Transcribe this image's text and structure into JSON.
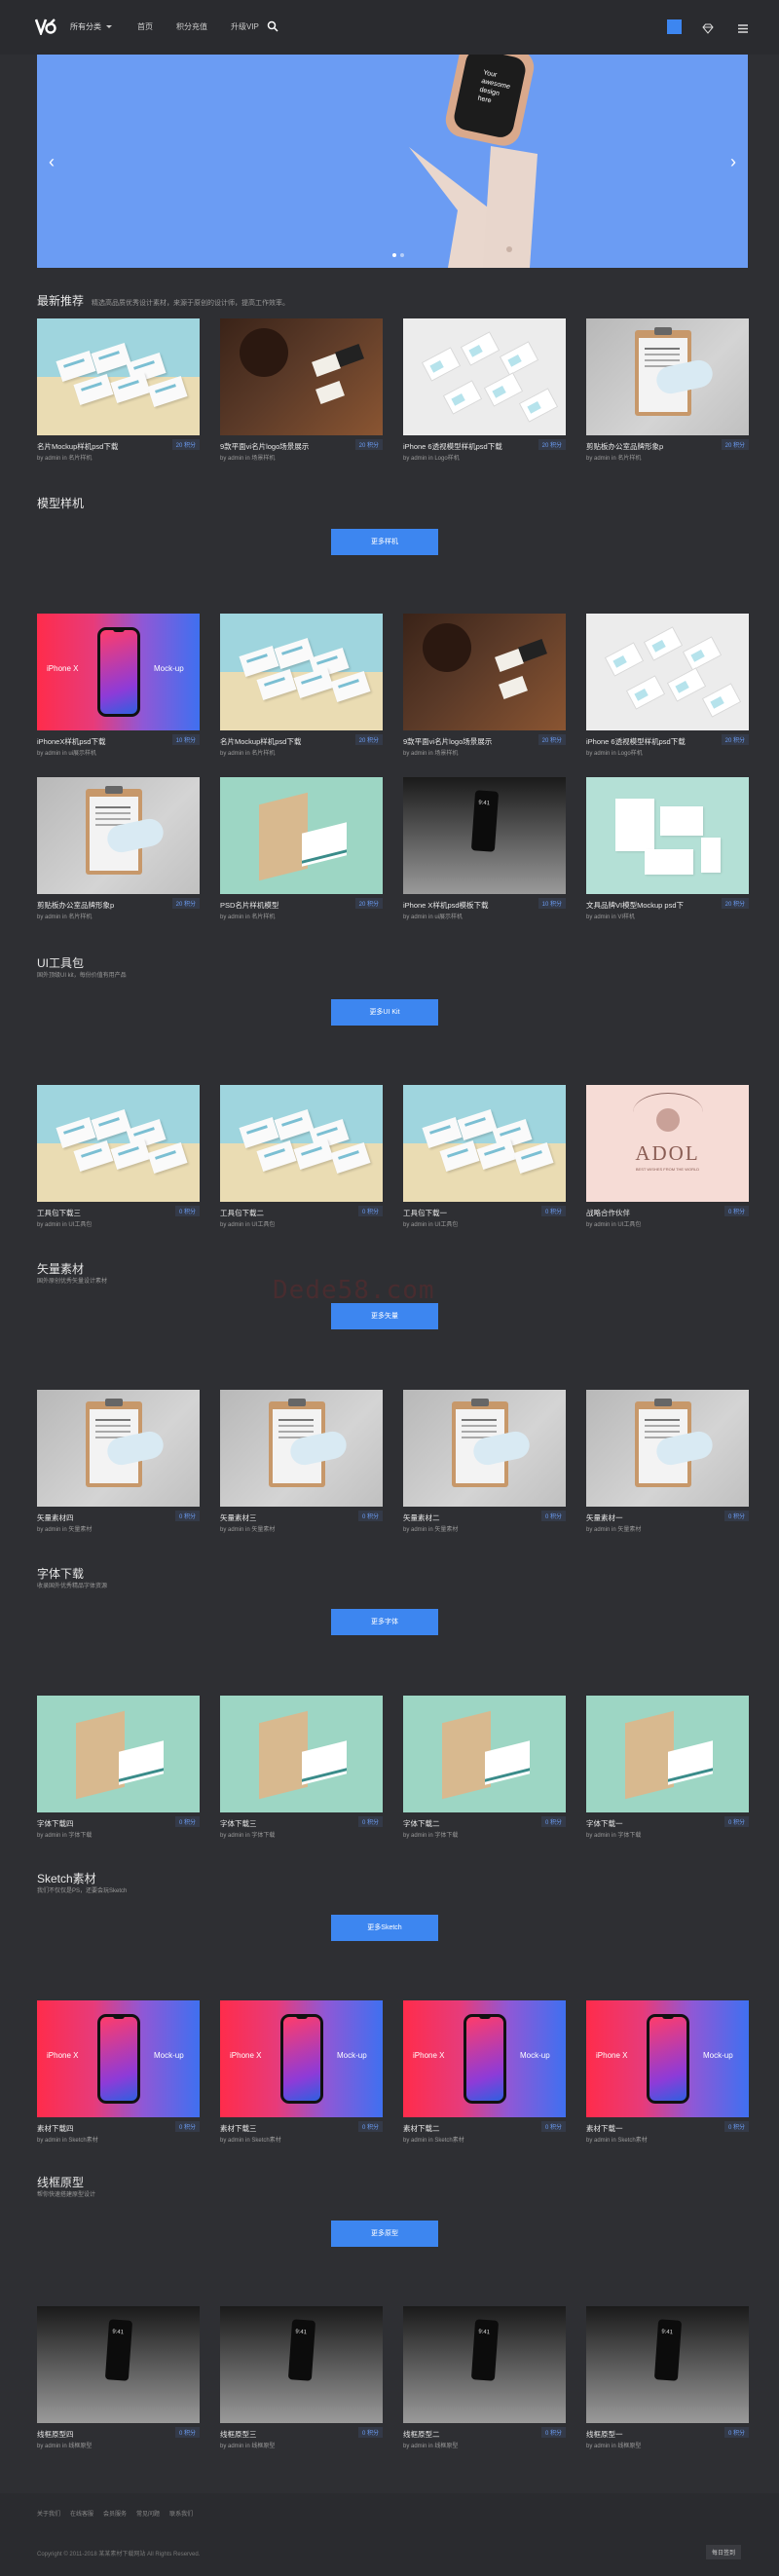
{
  "header": {
    "categories_label": "所有分类",
    "nav": [
      "首页",
      "积分充值",
      "升级VIP"
    ]
  },
  "banner": {
    "watch_text": "Your awesome design here"
  },
  "latest": {
    "title": "最新推荐",
    "subtitle": "精选高品质优秀设计素材，来源于原创的设计师，提高工作效率。",
    "cards": [
      {
        "title": "名片Mockup样机psd下载",
        "by": "by admin in 名片样机",
        "points": "20 积分",
        "art": "cards"
      },
      {
        "title": "9款平面vi名片logo场景展示",
        "by": "by admin in 场景样机",
        "points": "20 积分",
        "art": "dark"
      },
      {
        "title": "iPhone 6透视模型样机psd下载",
        "by": "by admin in Logo样机",
        "points": "20 积分",
        "art": "white"
      },
      {
        "title": "剪贴板办公室品牌形象p",
        "by": "by admin in 名片样机",
        "points": "20 积分",
        "art": "clip"
      }
    ]
  },
  "sections": [
    {
      "title": "模型样机",
      "subtitle": "",
      "button": "更多样机",
      "cards": [
        {
          "title": "iPhoneX样机psd下载",
          "by": "by admin in ui展示样机",
          "points": "10 积分",
          "art": "iphone"
        },
        {
          "title": "名片Mockup样机psd下载",
          "by": "by admin in 名片样机",
          "points": "20 积分",
          "art": "cards"
        },
        {
          "title": "9款平面vi名片logo场景展示",
          "by": "by admin in 场景样机",
          "points": "20 积分",
          "art": "dark"
        },
        {
          "title": "iPhone 6透视模型样机psd下载",
          "by": "by admin in Logo样机",
          "points": "20 积分",
          "art": "white"
        },
        {
          "title": "剪贴板办公室品牌形象p",
          "by": "by admin in 名片样机",
          "points": "20 积分",
          "art": "clip"
        },
        {
          "title": "PSD名片样机模型",
          "by": "by admin in 名片样机",
          "points": "20 积分",
          "art": "mint"
        },
        {
          "title": "iPhone X样机psd模板下载",
          "by": "by admin in ui展示样机",
          "points": "10 积分",
          "art": "gray"
        },
        {
          "title": "文具品牌VI模型Mockup psd下",
          "by": "by admin in VI样机",
          "points": "20 积分",
          "art": "mint2"
        }
      ]
    },
    {
      "title": "UI工具包",
      "subtitle": "国外顶级UI kit，每份价值有用产品",
      "button": "更多UI Kit",
      "cards": [
        {
          "title": "工具包下载三",
          "by": "by admin in UI工具包",
          "points": "0 积分",
          "art": "cards"
        },
        {
          "title": "工具包下载二",
          "by": "by admin in UI工具包",
          "points": "0 积分",
          "art": "cards"
        },
        {
          "title": "工具包下载一",
          "by": "by admin in UI工具包",
          "points": "0 积分",
          "art": "cards"
        },
        {
          "title": "战略合作伙伴",
          "by": "by admin in UI工具包",
          "points": "0 积分",
          "art": "pink"
        }
      ]
    },
    {
      "title": "矢量素材",
      "subtitle": "国外原创优秀矢量设计素材",
      "button": "更多矢量",
      "cards": [
        {
          "title": "矢量素材四",
          "by": "by admin in 矢量素材",
          "points": "0 积分",
          "art": "clip"
        },
        {
          "title": "矢量素材三",
          "by": "by admin in 矢量素材",
          "points": "0 积分",
          "art": "clip"
        },
        {
          "title": "矢量素材二",
          "by": "by admin in 矢量素材",
          "points": "0 积分",
          "art": "clip"
        },
        {
          "title": "矢量素材一",
          "by": "by admin in 矢量素材",
          "points": "0 积分",
          "art": "clip"
        }
      ]
    },
    {
      "title": "字体下载",
      "subtitle": "收录国外优秀精品字体资源",
      "button": "更多字体",
      "cards": [
        {
          "title": "字体下载四",
          "by": "by admin in 字体下载",
          "points": "0 积分",
          "art": "mint"
        },
        {
          "title": "字体下载三",
          "by": "by admin in 字体下载",
          "points": "0 积分",
          "art": "mint"
        },
        {
          "title": "字体下载二",
          "by": "by admin in 字体下载",
          "points": "0 积分",
          "art": "mint"
        },
        {
          "title": "字体下载一",
          "by": "by admin in 字体下载",
          "points": "0 积分",
          "art": "mint"
        }
      ]
    },
    {
      "title": "Sketch素材",
      "subtitle": "我们不仅仅是PS，还要会玩Sketch",
      "button": "更多Sketch",
      "cards": [
        {
          "title": "素材下载四",
          "by": "by admin in Sketch素材",
          "points": "0 积分",
          "art": "iphone"
        },
        {
          "title": "素材下载三",
          "by": "by admin in Sketch素材",
          "points": "0 积分",
          "art": "iphone"
        },
        {
          "title": "素材下载二",
          "by": "by admin in Sketch素材",
          "points": "0 积分",
          "art": "iphone"
        },
        {
          "title": "素材下载一",
          "by": "by admin in Sketch素材",
          "points": "0 积分",
          "art": "iphone"
        }
      ]
    },
    {
      "title": "线框原型",
      "subtitle": "帮你快速搭建原型设计",
      "button": "更多原型",
      "cards": [
        {
          "title": "线框原型四",
          "by": "by admin in 线框原型",
          "points": "0 积分",
          "art": "gray"
        },
        {
          "title": "线框原型三",
          "by": "by admin in 线框原型",
          "points": "0 积分",
          "art": "gray"
        },
        {
          "title": "线框原型二",
          "by": "by admin in 线框原型",
          "points": "0 积分",
          "art": "gray"
        },
        {
          "title": "线框原型一",
          "by": "by admin in 线框原型",
          "points": "0 积分",
          "art": "gray"
        }
      ]
    }
  ],
  "pink_art": {
    "brand": "ADOL",
    "tagline": "BEST WISHES FROM THE WORLD"
  },
  "watermark": "Dede58.com",
  "footer": {
    "links": [
      "关于我们",
      "在线客服",
      "会员服务",
      "常见问题",
      "联系我们"
    ],
    "copyright": "Copyright © 2011-2018 某某素材下载网站 All Rights Reserved.",
    "sign_label": "每日签到"
  },
  "colors": {
    "accent": "#3d86f0",
    "banner": "#6b9cf3",
    "background": "#2e2f33"
  }
}
